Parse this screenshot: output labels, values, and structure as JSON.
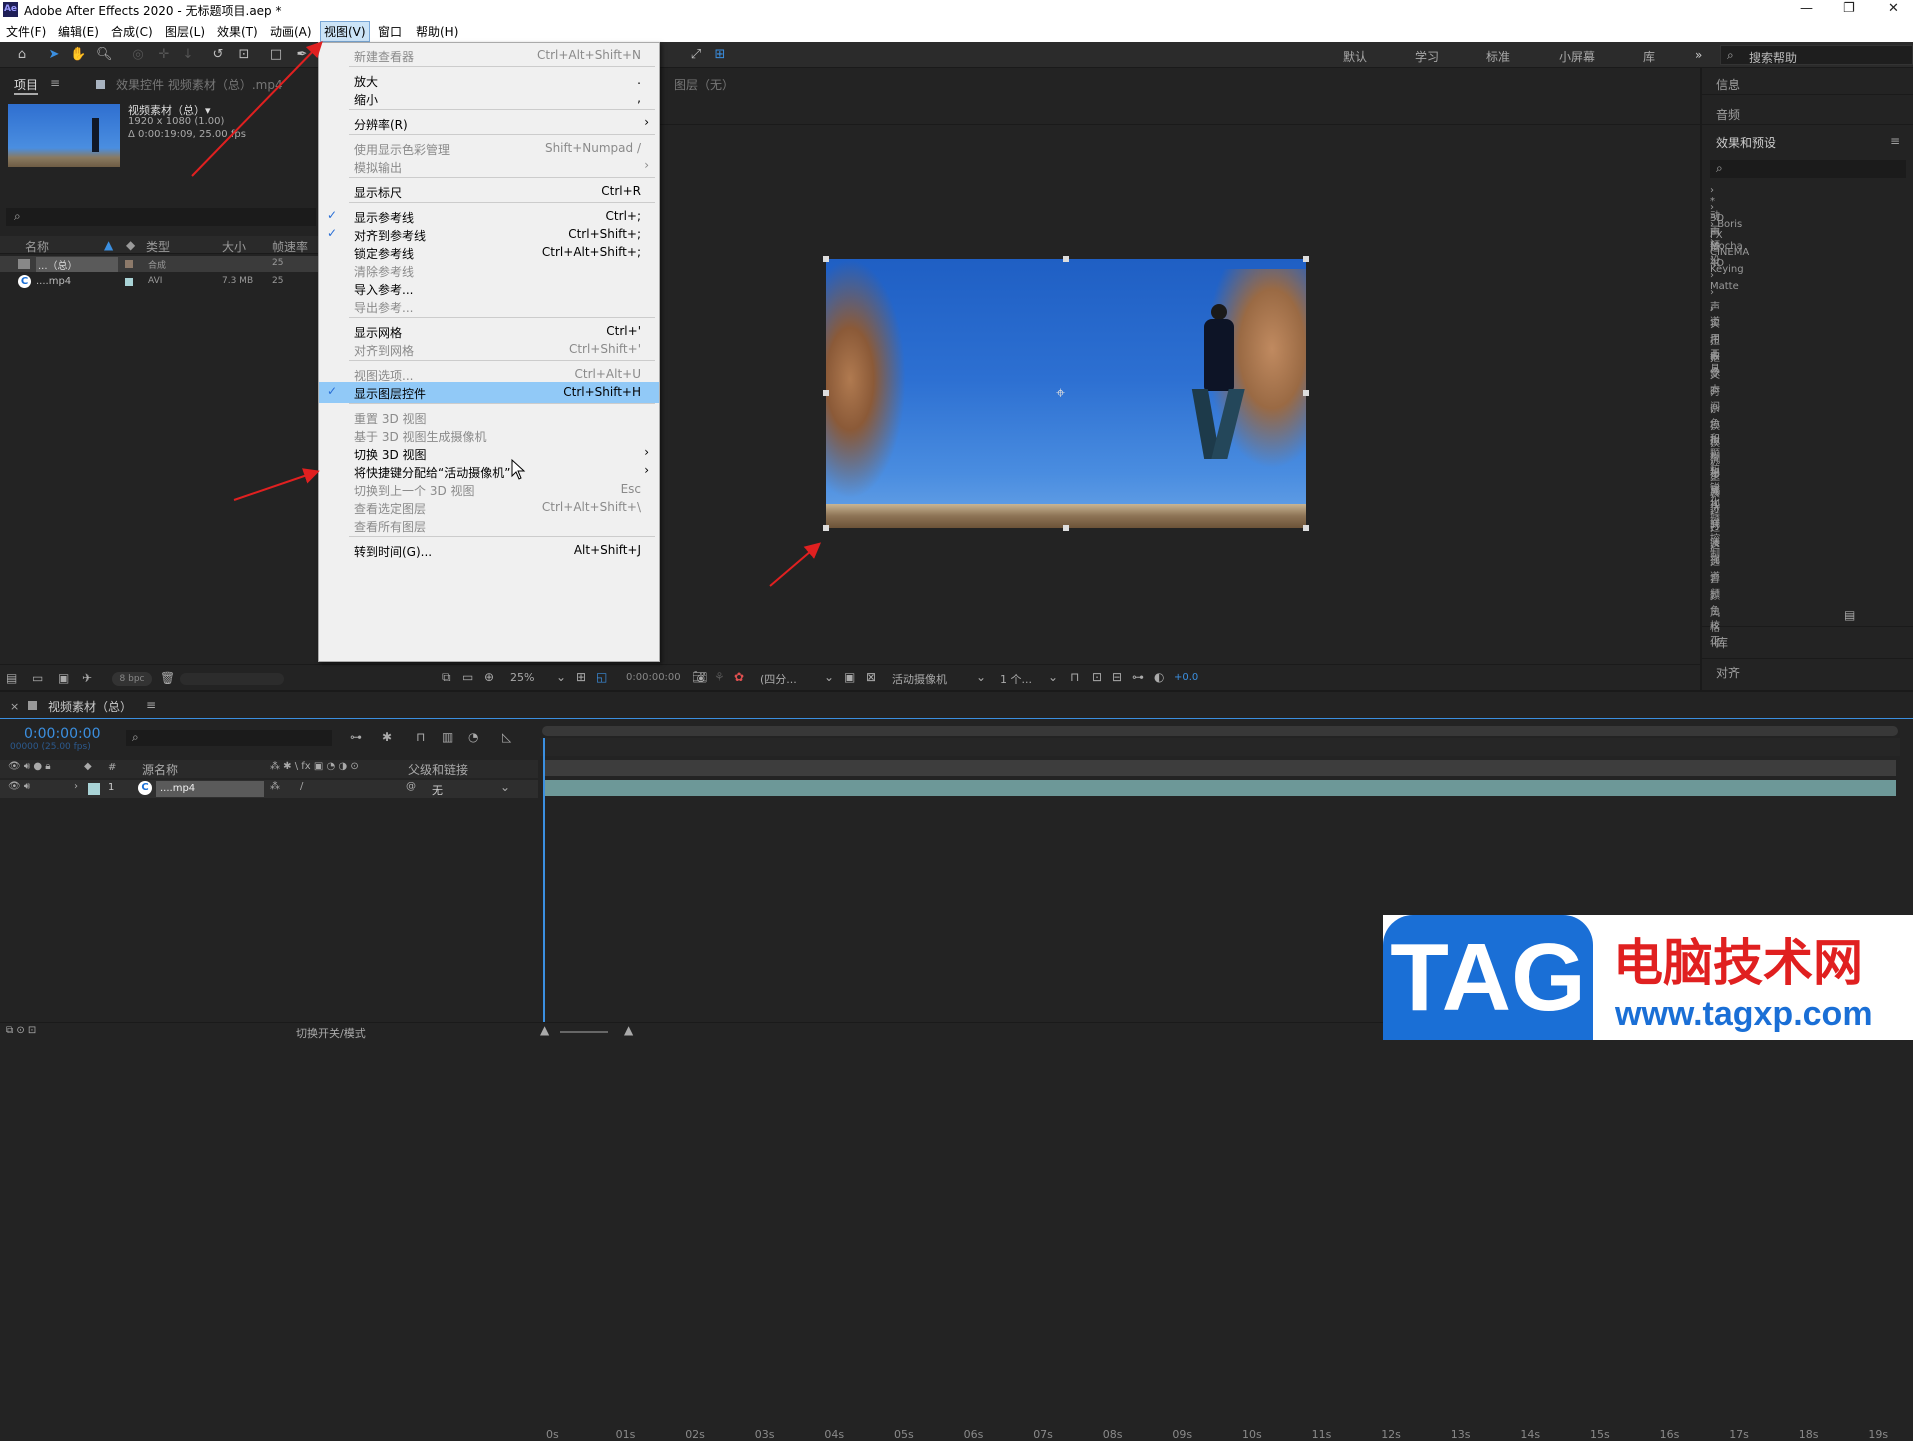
{
  "window": {
    "title": "Adobe After Effects 2020 - 无标题项目.aep *",
    "logo": "Ae",
    "controls": [
      "—",
      "❐",
      "✕"
    ]
  },
  "menubar": [
    "文件(F)",
    "编辑(E)",
    "合成(C)",
    "图层(L)",
    "效果(T)",
    "动画(A)",
    "视图(V)",
    "窗口",
    "帮助(H)"
  ],
  "workspaces": [
    "默认",
    "学习",
    "标准",
    "小屏幕",
    "库"
  ],
  "search_help": "搜索帮助",
  "project": {
    "tab": "项目",
    "effect_tab": "效果控件 视频素材（总）.mp4",
    "item_name": "视频素材（总）▾",
    "item_res": "1920 x 1080 (1.00)",
    "item_dur": "Δ 0:00:19:09, 25.00 fps",
    "columns": [
      "名称",
      "类型",
      "大小",
      "帧速率"
    ],
    "rows": [
      {
        "name": "...（总）",
        "type": "合成",
        "size": "",
        "fps": "25"
      },
      {
        "name": "....mp4",
        "type": "AVI",
        "size": "7.3 MB",
        "fps": "25"
      }
    ],
    "bpc": "8 bpc"
  },
  "viewer": {
    "layer_label": "图层（无）",
    "zoom": "25%",
    "timecode": "0:00:00:00",
    "resolution": "(四分...",
    "camera": "活动摄像机",
    "views": "1 个...",
    "offset": "+0.0"
  },
  "dropdown": [
    {
      "label": "新建查看器",
      "shortcut": "Ctrl+Alt+Shift+N",
      "disabled": true
    },
    {
      "sep": true
    },
    {
      "label": "放大",
      "shortcut": "."
    },
    {
      "label": "缩小",
      "shortcut": ","
    },
    {
      "sep": true
    },
    {
      "label": "分辨率(R)",
      "arrow": true
    },
    {
      "sep": true
    },
    {
      "label": "使用显示色彩管理",
      "shortcut": "Shift+Numpad /",
      "disabled": true
    },
    {
      "label": "模拟输出",
      "arrow": true,
      "disabled": true
    },
    {
      "sep": true
    },
    {
      "label": "显示标尺",
      "shortcut": "Ctrl+R"
    },
    {
      "sep": true
    },
    {
      "label": "显示参考线",
      "shortcut": "Ctrl+;",
      "checked": true
    },
    {
      "label": "对齐到参考线",
      "shortcut": "Ctrl+Shift+;",
      "checked": true
    },
    {
      "label": "锁定参考线",
      "shortcut": "Ctrl+Alt+Shift+;"
    },
    {
      "label": "清除参考线",
      "disabled": true
    },
    {
      "label": "导入参考...",
      "shortcut": ""
    },
    {
      "label": "导出参考...",
      "disabled": true
    },
    {
      "sep": true
    },
    {
      "label": "显示网格",
      "shortcut": "Ctrl+'"
    },
    {
      "label": "对齐到网格",
      "shortcut": "Ctrl+Shift+'",
      "disabled": true
    },
    {
      "sep": true
    },
    {
      "label": "视图选项...",
      "shortcut": "Ctrl+Alt+U",
      "disabled": true
    },
    {
      "label": "显示图层控件",
      "shortcut": "Ctrl+Shift+H",
      "checked": true,
      "highlight": true
    },
    {
      "sep": true
    },
    {
      "label": "重置 3D 视图",
      "disabled": true
    },
    {
      "label": "基于 3D 视图生成摄像机",
      "disabled": true
    },
    {
      "label": "切换 3D 视图",
      "arrow": true
    },
    {
      "label": "将快捷键分配给“活动摄像机”",
      "arrow": true
    },
    {
      "label": "切换到上一个 3D 视图",
      "shortcut": "Esc",
      "disabled": true
    },
    {
      "label": "查看选定图层",
      "shortcut": "Ctrl+Alt+Shift+\\",
      "disabled": true
    },
    {
      "label": "查看所有图层",
      "disabled": true
    },
    {
      "sep": true
    },
    {
      "label": "转到时间(G)...",
      "shortcut": "Alt+Shift+J"
    }
  ],
  "right_panel": {
    "info": "信息",
    "audio": "音频",
    "effects": "效果和预设",
    "tree": [
      "* 动画预设",
      "3D 声道",
      "Boris FX Mocha",
      "CINEMA 4D",
      "Keying",
      "Matte",
      "声道",
      "实用工具",
      "扭曲",
      "抠像",
      "文本",
      "时间",
      "杂色和颗粒",
      "模拟",
      "模糊和锐化",
      "沉浸式视频",
      "生成",
      "表达式控制",
      "过时",
      "过渡",
      "透视",
      "通道",
      "音频",
      "颜色校正",
      "风格化"
    ],
    "library": "库",
    "align": "对齐"
  },
  "timeline": {
    "tab": "视频素材（总）",
    "timecode": "0:00:00:00",
    "sub_tc": "00000 (25.00 fps)",
    "col_source": "源名称",
    "col_parent": "父级和链接",
    "layer_num": "1",
    "layer_name": "....mp4",
    "parent_val": "无",
    "ticks": [
      "0s",
      "01s",
      "02s",
      "03s",
      "04s",
      "05s",
      "06s",
      "07s",
      "08s",
      "09s",
      "10s",
      "11s",
      "12s",
      "13s",
      "14s",
      "15s",
      "16s",
      "17s",
      "18s",
      "19s"
    ],
    "footer": "切换开关/模式"
  },
  "watermark": {
    "tag": "TAG",
    "cn": "电脑技术网",
    "url": "www.tagxp.com"
  }
}
